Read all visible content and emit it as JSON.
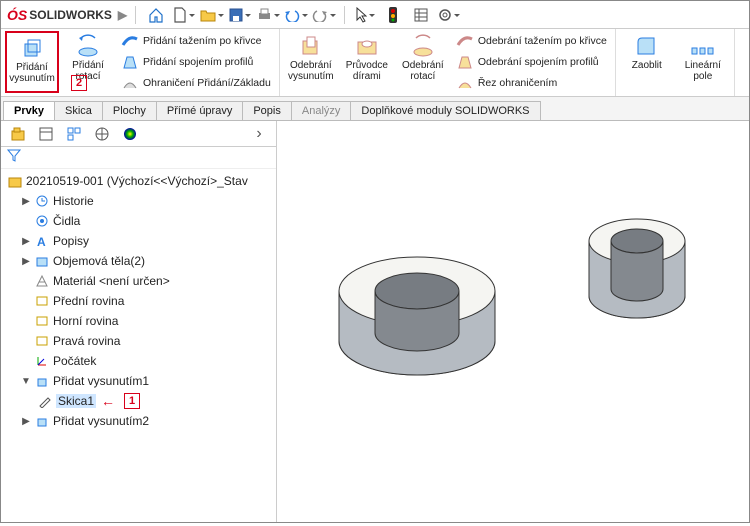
{
  "app": {
    "name": "SOLIDWORKS"
  },
  "toolbar_icons": {
    "home": "home-icon",
    "new": "new-icon",
    "open": "open-icon",
    "save": "save-icon",
    "print": "print-icon",
    "undo": "undo-icon",
    "redo": "redo-icon",
    "select": "select-icon",
    "rebuild": "rebuild-icon",
    "bom": "bom-icon",
    "settings": "settings-icon"
  },
  "ribbon": {
    "extrude": {
      "label": "Přidání\nvysunutím"
    },
    "revolve": {
      "label": "Přidání\nrotací"
    },
    "sweep": {
      "label": "Přidání tažením po křivce"
    },
    "loft": {
      "label": "Přidání spojením profilů"
    },
    "boundary": {
      "label": "Ohraničení Přidání/Základu"
    },
    "cut_ext": {
      "label": "Odebrání\nvysunutím"
    },
    "hole": {
      "label": "Průvodce\ndírami"
    },
    "cut_rev": {
      "label": "Odebrání\nrotací"
    },
    "cut_sweep": {
      "label": "Odebrání tažením po křivce"
    },
    "cut_loft": {
      "label": "Odebrání spojením profilů"
    },
    "cut_bound": {
      "label": "Řez ohraničením"
    },
    "fillet": {
      "label": "Zaoblit"
    },
    "linpat": {
      "label": "Lineární\npole"
    }
  },
  "tabs": [
    {
      "label": "Prvky",
      "active": true
    },
    {
      "label": "Skica"
    },
    {
      "label": "Plochy"
    },
    {
      "label": "Přímé úpravy"
    },
    {
      "label": "Popis"
    },
    {
      "label": "Analýzy",
      "dimmed": true
    },
    {
      "label": "Doplňkové moduly SOLIDWORKS"
    }
  ],
  "tree": {
    "root": "20210519-001  (Výchozí<<Výchozí>_Stav",
    "history": "Historie",
    "sensors": "Čidla",
    "annotations": "Popisy",
    "bodies": "Objemová těla(2)",
    "material": "Materiál <není určen>",
    "front": "Přední rovina",
    "top": "Horní rovina",
    "right": "Pravá rovina",
    "origin": "Počátek",
    "feat1": "Přidat vysunutím1",
    "sketch1": "Skica1",
    "feat2": "Přidat vysunutím2"
  },
  "callouts": {
    "step1": "1",
    "step2": "2"
  }
}
